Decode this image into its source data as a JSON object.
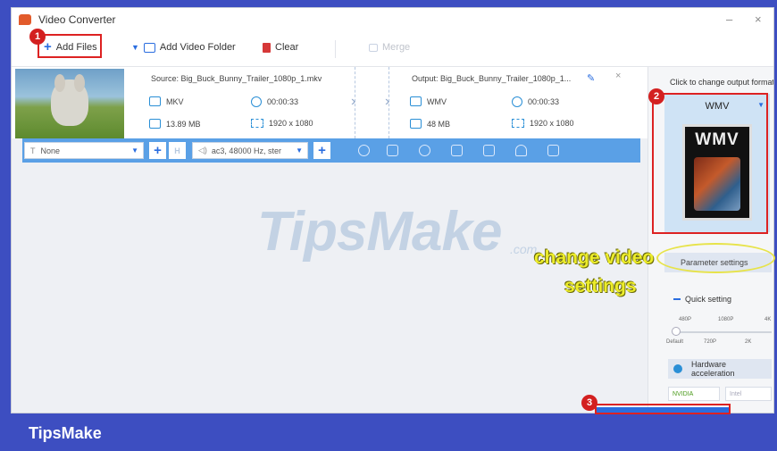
{
  "window": {
    "title": "Video Converter",
    "minimize": "–",
    "close": "×"
  },
  "toolbar": {
    "add_files": "Add Files",
    "add_folder": "Add Video Folder",
    "clear": "Clear",
    "merge": "Merge"
  },
  "file": {
    "source": "Source: Big_Buck_Bunny_Trailer_1080p_1.mkv",
    "src_format": "MKV",
    "src_duration": "00:00:33",
    "src_size": "13.89 MB",
    "src_resolution": "1920 x 1080",
    "output": "Output: Big_Buck_Bunny_Trailer_1080p_1...",
    "out_format": "WMV",
    "out_duration": "00:00:33",
    "out_size": "48 MB",
    "out_resolution": "1920 x 1080",
    "close": "×"
  },
  "edit_bar": {
    "subtitle_value": "None",
    "audio_value": "ac3, 48000 Hz, ster"
  },
  "right_panel": {
    "click_label": "Click to change output format:",
    "format_name": "WMV",
    "icon_text": "WMV",
    "param_settings": "Parameter settings",
    "quick_setting": "Quick setting",
    "q_top": [
      "480P",
      "1080P",
      "4K"
    ],
    "q_bottom": [
      "Default",
      "720P",
      "2K"
    ],
    "hw_accel": "Hardware acceleration",
    "nvidia": "NVIDIA",
    "intel": "Intel"
  },
  "annotations": {
    "badge1": "1",
    "badge2": "2",
    "badge3": "3",
    "highlight_line1": "change video",
    "highlight_line2": "settings"
  },
  "watermark": {
    "main": "TipsMake",
    "suffix": ".com"
  },
  "footer": {
    "brand": "TipsMake"
  },
  "colors": {
    "accent": "#2a6de0",
    "edit_bar": "#5aa0e6",
    "frame": "#3d4ec1",
    "annotation_red": "#d32020",
    "highlight_yellow": "#ecec2a"
  }
}
